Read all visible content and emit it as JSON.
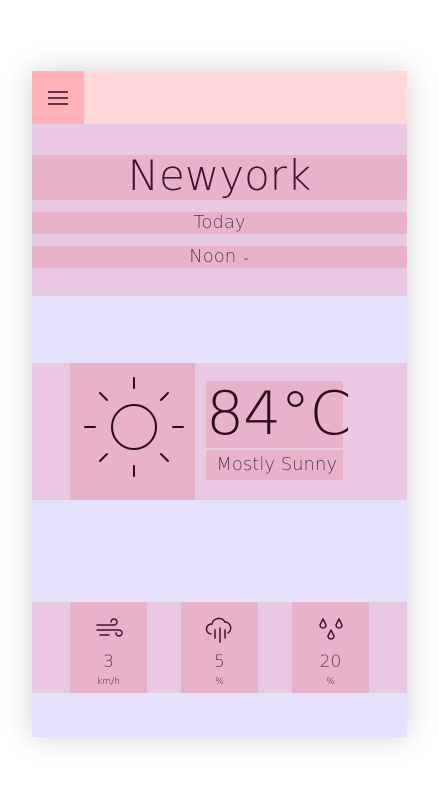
{
  "header": {
    "menu_icon": "hamburger-menu-icon"
  },
  "location": {
    "city": "Newyork",
    "day": "Today",
    "time": "Noon"
  },
  "current": {
    "icon": "sun-icon",
    "temperature": "84°C",
    "condition": "Mostly Sunny"
  },
  "stats": [
    {
      "icon": "wind-icon",
      "value": "3",
      "unit": "km/h"
    },
    {
      "icon": "rain-cloud-icon",
      "value": "5",
      "unit": "%"
    },
    {
      "icon": "humidity-drops-icon",
      "value": "20",
      "unit": "%"
    }
  ],
  "colors": {
    "background": "#e6e2fe",
    "topbar": "#ffd9da",
    "menu_button": "#ffb3b8",
    "band": "#e9c8e3",
    "panel": "#e8b2ca",
    "text_dark": "#2e0a22"
  }
}
